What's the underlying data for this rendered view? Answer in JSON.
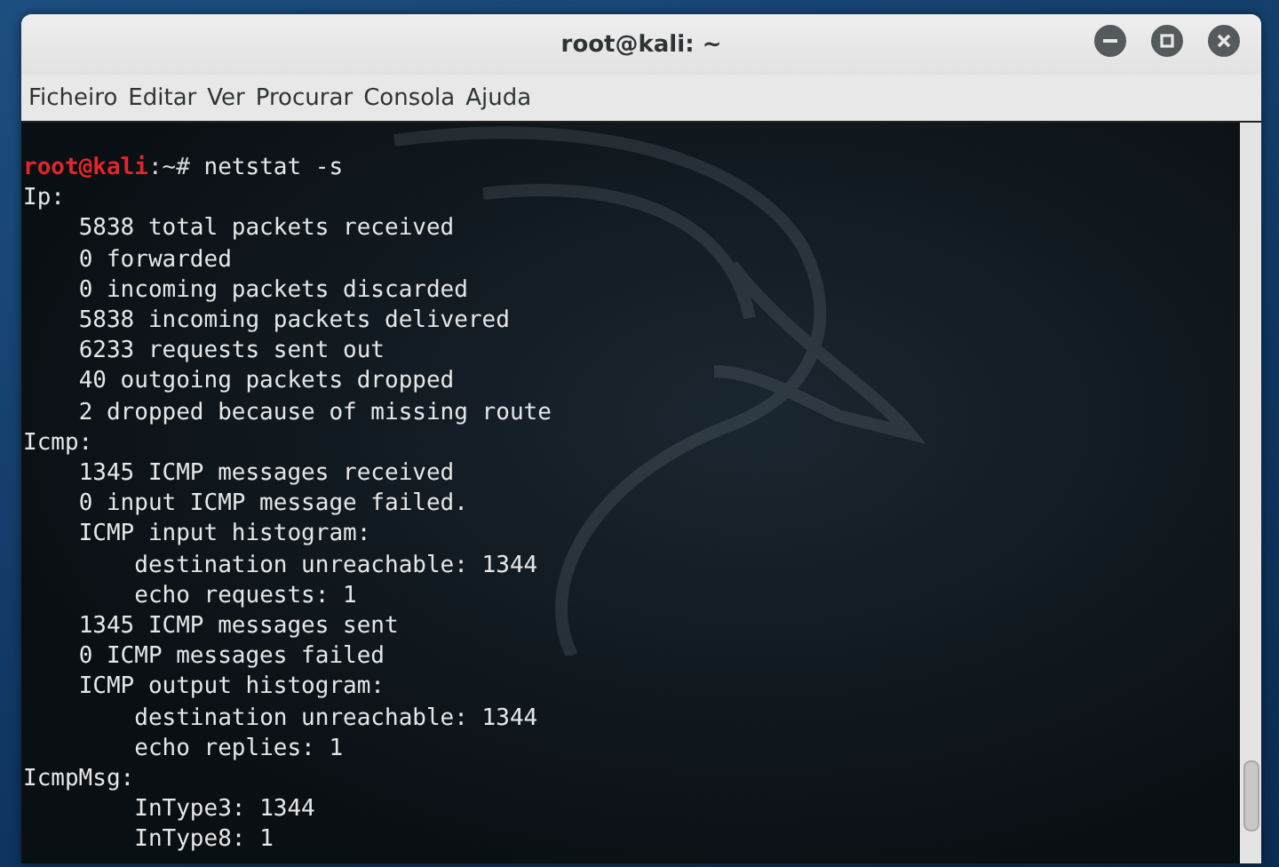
{
  "window": {
    "title": "root@kali: ~"
  },
  "menu": [
    "Ficheiro",
    "Editar",
    "Ver",
    "Procurar",
    "Consola",
    "Ajuda"
  ],
  "terminal": {
    "prompt": {
      "user_host": "root@kali",
      "path": ":~#",
      "command": "netstat -s"
    },
    "output": [
      {
        "text": "Ip:",
        "children": [
          {
            "text": "5838 total packets received"
          },
          {
            "text": "0 forwarded"
          },
          {
            "text": "0 incoming packets discarded"
          },
          {
            "text": "5838 incoming packets delivered"
          },
          {
            "text": "6233 requests sent out"
          },
          {
            "text": "40 outgoing packets dropped"
          },
          {
            "text": "2 dropped because of missing route"
          }
        ]
      },
      {
        "text": "Icmp:",
        "children": [
          {
            "text": "1345 ICMP messages received"
          },
          {
            "text": "0 input ICMP message failed."
          },
          {
            "text": "ICMP input histogram:",
            "children": [
              {
                "text": "destination unreachable: 1344"
              },
              {
                "text": "echo requests: 1"
              }
            ]
          },
          {
            "text": "1345 ICMP messages sent"
          },
          {
            "text": "0 ICMP messages failed"
          },
          {
            "text": "ICMP output histogram:",
            "children": [
              {
                "text": "destination unreachable: 1344"
              },
              {
                "text": "echo replies: 1"
              }
            ]
          }
        ]
      },
      {
        "text": "IcmpMsg:",
        "children": [
          {
            "children": [
              {
                "text": "InType3: 1344"
              },
              {
                "text": "InType8: 1"
              }
            ]
          }
        ]
      }
    ]
  }
}
